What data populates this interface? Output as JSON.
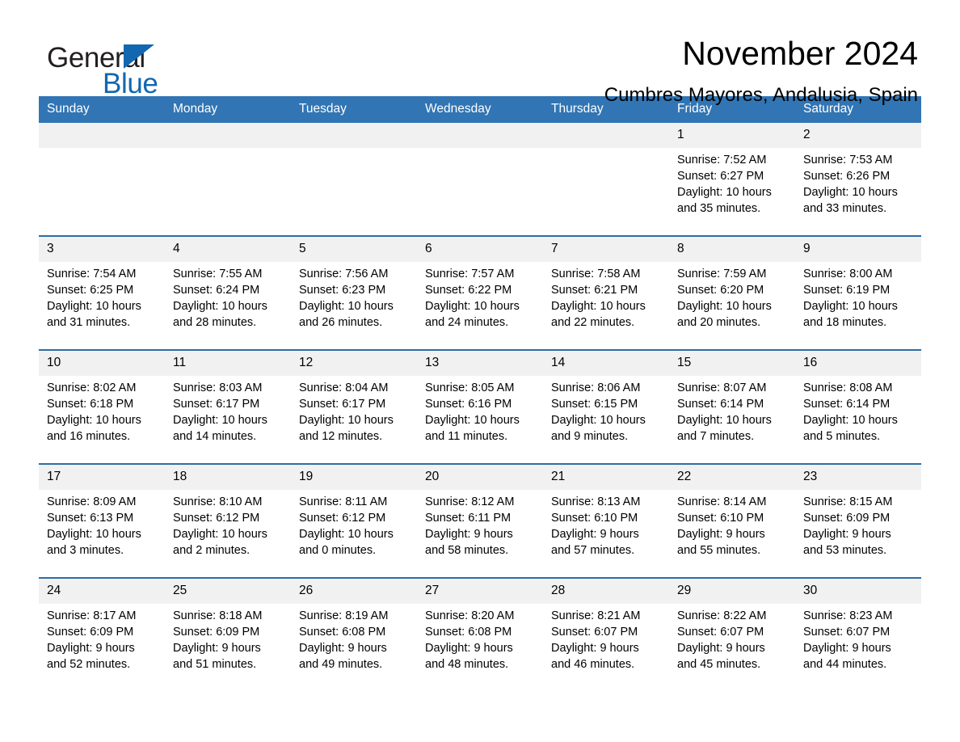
{
  "brand": {
    "name_part1": "General",
    "name_part2": "Blue",
    "triangle_color": "#1267b0",
    "text_color": "#231f20"
  },
  "header": {
    "month_title": "November 2024",
    "location": "Cumbres Mayores, Andalusia, Spain"
  },
  "theme": {
    "header_blue": "#3175b4",
    "rule_blue": "#2e6da4",
    "date_band_gray": "#f1f1f1"
  },
  "calendar": {
    "weekdays": [
      "Sunday",
      "Monday",
      "Tuesday",
      "Wednesday",
      "Thursday",
      "Friday",
      "Saturday"
    ],
    "weeks": [
      [
        {
          "day": "",
          "lines": []
        },
        {
          "day": "",
          "lines": []
        },
        {
          "day": "",
          "lines": []
        },
        {
          "day": "",
          "lines": []
        },
        {
          "day": "",
          "lines": []
        },
        {
          "day": "1",
          "lines": [
            "Sunrise: 7:52 AM",
            "Sunset: 6:27 PM",
            "Daylight: 10 hours",
            "and 35 minutes."
          ]
        },
        {
          "day": "2",
          "lines": [
            "Sunrise: 7:53 AM",
            "Sunset: 6:26 PM",
            "Daylight: 10 hours",
            "and 33 minutes."
          ]
        }
      ],
      [
        {
          "day": "3",
          "lines": [
            "Sunrise: 7:54 AM",
            "Sunset: 6:25 PM",
            "Daylight: 10 hours",
            "and 31 minutes."
          ]
        },
        {
          "day": "4",
          "lines": [
            "Sunrise: 7:55 AM",
            "Sunset: 6:24 PM",
            "Daylight: 10 hours",
            "and 28 minutes."
          ]
        },
        {
          "day": "5",
          "lines": [
            "Sunrise: 7:56 AM",
            "Sunset: 6:23 PM",
            "Daylight: 10 hours",
            "and 26 minutes."
          ]
        },
        {
          "day": "6",
          "lines": [
            "Sunrise: 7:57 AM",
            "Sunset: 6:22 PM",
            "Daylight: 10 hours",
            "and 24 minutes."
          ]
        },
        {
          "day": "7",
          "lines": [
            "Sunrise: 7:58 AM",
            "Sunset: 6:21 PM",
            "Daylight: 10 hours",
            "and 22 minutes."
          ]
        },
        {
          "day": "8",
          "lines": [
            "Sunrise: 7:59 AM",
            "Sunset: 6:20 PM",
            "Daylight: 10 hours",
            "and 20 minutes."
          ]
        },
        {
          "day": "9",
          "lines": [
            "Sunrise: 8:00 AM",
            "Sunset: 6:19 PM",
            "Daylight: 10 hours",
            "and 18 minutes."
          ]
        }
      ],
      [
        {
          "day": "10",
          "lines": [
            "Sunrise: 8:02 AM",
            "Sunset: 6:18 PM",
            "Daylight: 10 hours",
            "and 16 minutes."
          ]
        },
        {
          "day": "11",
          "lines": [
            "Sunrise: 8:03 AM",
            "Sunset: 6:17 PM",
            "Daylight: 10 hours",
            "and 14 minutes."
          ]
        },
        {
          "day": "12",
          "lines": [
            "Sunrise: 8:04 AM",
            "Sunset: 6:17 PM",
            "Daylight: 10 hours",
            "and 12 minutes."
          ]
        },
        {
          "day": "13",
          "lines": [
            "Sunrise: 8:05 AM",
            "Sunset: 6:16 PM",
            "Daylight: 10 hours",
            "and 11 minutes."
          ]
        },
        {
          "day": "14",
          "lines": [
            "Sunrise: 8:06 AM",
            "Sunset: 6:15 PM",
            "Daylight: 10 hours",
            "and 9 minutes."
          ]
        },
        {
          "day": "15",
          "lines": [
            "Sunrise: 8:07 AM",
            "Sunset: 6:14 PM",
            "Daylight: 10 hours",
            "and 7 minutes."
          ]
        },
        {
          "day": "16",
          "lines": [
            "Sunrise: 8:08 AM",
            "Sunset: 6:14 PM",
            "Daylight: 10 hours",
            "and 5 minutes."
          ]
        }
      ],
      [
        {
          "day": "17",
          "lines": [
            "Sunrise: 8:09 AM",
            "Sunset: 6:13 PM",
            "Daylight: 10 hours",
            "and 3 minutes."
          ]
        },
        {
          "day": "18",
          "lines": [
            "Sunrise: 8:10 AM",
            "Sunset: 6:12 PM",
            "Daylight: 10 hours",
            "and 2 minutes."
          ]
        },
        {
          "day": "19",
          "lines": [
            "Sunrise: 8:11 AM",
            "Sunset: 6:12 PM",
            "Daylight: 10 hours",
            "and 0 minutes."
          ]
        },
        {
          "day": "20",
          "lines": [
            "Sunrise: 8:12 AM",
            "Sunset: 6:11 PM",
            "Daylight: 9 hours",
            "and 58 minutes."
          ]
        },
        {
          "day": "21",
          "lines": [
            "Sunrise: 8:13 AM",
            "Sunset: 6:10 PM",
            "Daylight: 9 hours",
            "and 57 minutes."
          ]
        },
        {
          "day": "22",
          "lines": [
            "Sunrise: 8:14 AM",
            "Sunset: 6:10 PM",
            "Daylight: 9 hours",
            "and 55 minutes."
          ]
        },
        {
          "day": "23",
          "lines": [
            "Sunrise: 8:15 AM",
            "Sunset: 6:09 PM",
            "Daylight: 9 hours",
            "and 53 minutes."
          ]
        }
      ],
      [
        {
          "day": "24",
          "lines": [
            "Sunrise: 8:17 AM",
            "Sunset: 6:09 PM",
            "Daylight: 9 hours",
            "and 52 minutes."
          ]
        },
        {
          "day": "25",
          "lines": [
            "Sunrise: 8:18 AM",
            "Sunset: 6:09 PM",
            "Daylight: 9 hours",
            "and 51 minutes."
          ]
        },
        {
          "day": "26",
          "lines": [
            "Sunrise: 8:19 AM",
            "Sunset: 6:08 PM",
            "Daylight: 9 hours",
            "and 49 minutes."
          ]
        },
        {
          "day": "27",
          "lines": [
            "Sunrise: 8:20 AM",
            "Sunset: 6:08 PM",
            "Daylight: 9 hours",
            "and 48 minutes."
          ]
        },
        {
          "day": "28",
          "lines": [
            "Sunrise: 8:21 AM",
            "Sunset: 6:07 PM",
            "Daylight: 9 hours",
            "and 46 minutes."
          ]
        },
        {
          "day": "29",
          "lines": [
            "Sunrise: 8:22 AM",
            "Sunset: 6:07 PM",
            "Daylight: 9 hours",
            "and 45 minutes."
          ]
        },
        {
          "day": "30",
          "lines": [
            "Sunrise: 8:23 AM",
            "Sunset: 6:07 PM",
            "Daylight: 9 hours",
            "and 44 minutes."
          ]
        }
      ]
    ]
  }
}
